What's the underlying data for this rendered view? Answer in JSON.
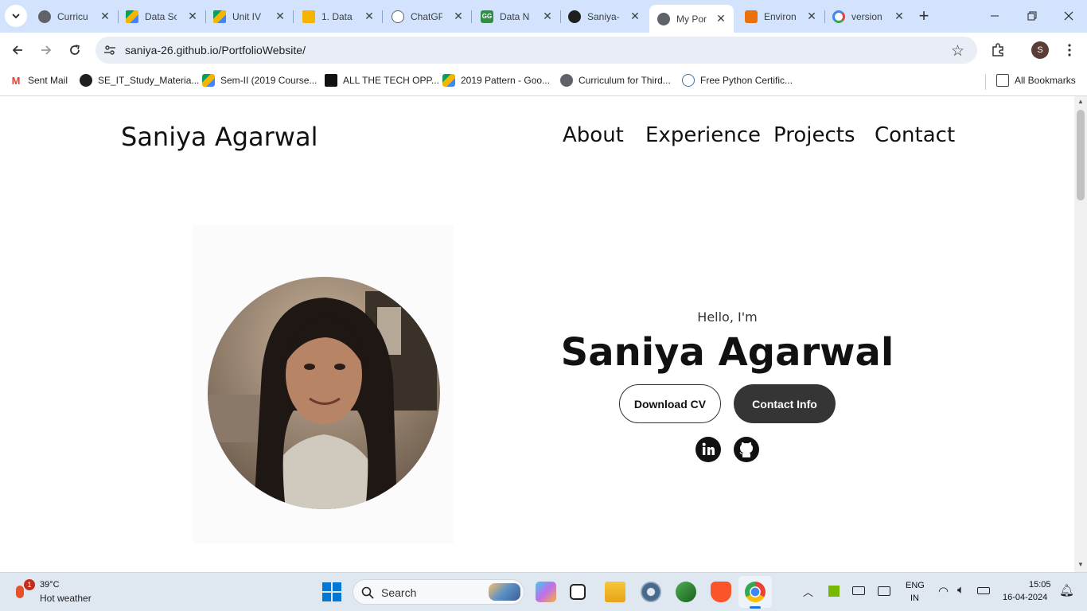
{
  "browser": {
    "tabs": [
      {
        "title": "Curricu",
        "icon": "globe-icon"
      },
      {
        "title": "Data Sc",
        "icon": "drive-icon"
      },
      {
        "title": "Unit IV",
        "icon": "drive-icon"
      },
      {
        "title": "1. Data",
        "icon": "slides-icon"
      },
      {
        "title": "ChatGP",
        "icon": "chatgpt-icon"
      },
      {
        "title": "Data N",
        "icon": "gfg-icon"
      },
      {
        "title": "Saniya-",
        "icon": "github-icon"
      },
      {
        "title": "My Por",
        "icon": "globe-icon"
      },
      {
        "title": "Environ",
        "icon": "env-icon"
      },
      {
        "title": "version",
        "icon": "google-icon"
      }
    ],
    "url": "saniya-26.github.io/PortfolioWebsite/",
    "profile_initial": "S",
    "bookmarks": [
      {
        "label": "Sent Mail",
        "icon": "gmail-icon"
      },
      {
        "label": "SE_IT_Study_Materia...",
        "icon": "github-icon"
      },
      {
        "label": "Sem-II (2019 Course...",
        "icon": "drive-icon"
      },
      {
        "label": "ALL THE TECH OPP...",
        "icon": "tech-icon"
      },
      {
        "label": "2019 Pattern - Goo...",
        "icon": "drive-icon"
      },
      {
        "label": "Curriculum for Third...",
        "icon": "globe-icon"
      },
      {
        "label": "Free Python Certific...",
        "icon": "python-icon"
      }
    ],
    "all_bookmarks": "All Bookmarks"
  },
  "site": {
    "brand": "Saniya Agarwal",
    "nav": [
      "About",
      "Experience",
      "Projects",
      "Contact"
    ],
    "hero": {
      "greeting": "Hello, I'm",
      "name": "Saniya Agarwal",
      "download_cv": "Download CV",
      "contact_info": "Contact Info"
    }
  },
  "taskbar": {
    "weather_temp": "39°C",
    "weather_desc": "Hot weather",
    "weather_badge": "1",
    "search_placeholder": "Search",
    "lang_top": "ENG",
    "lang_bottom": "IN",
    "time": "15:05",
    "date": "16-04-2024"
  },
  "colors": {
    "tabstrip": "#d3e3fd",
    "button_dark": "#353535"
  }
}
